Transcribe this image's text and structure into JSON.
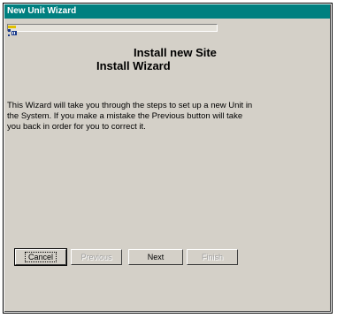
{
  "window": {
    "title": "New Unit Wizard"
  },
  "header": {
    "line1": "Install new Site",
    "line2": "Install  Wizard"
  },
  "body": {
    "text": "This Wizard will take you through the steps to set up a new Unit in the System.  If you make a mistake the Previous button will take you back in order for you to correct it."
  },
  "buttons": {
    "cancel": "Cancel",
    "previous": "Previous",
    "next": "Next",
    "finish": "Finish"
  }
}
